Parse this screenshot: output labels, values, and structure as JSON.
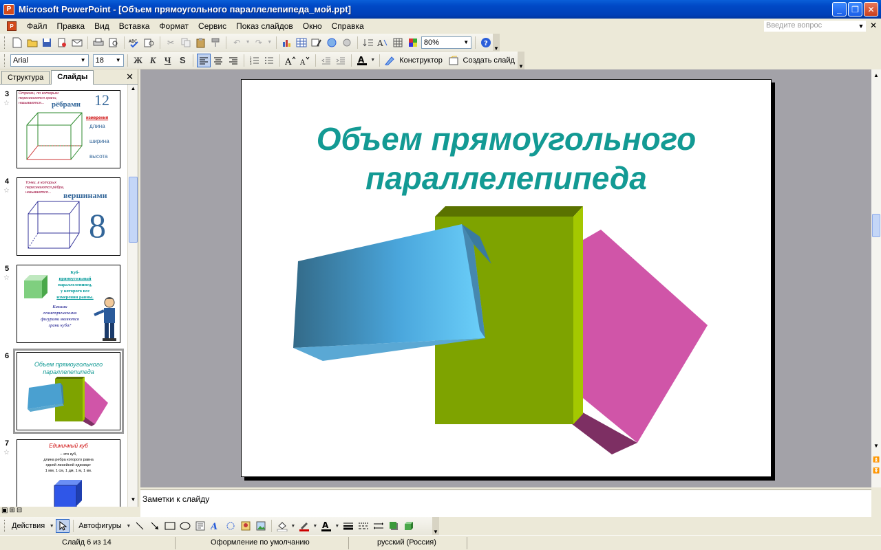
{
  "window": {
    "title": "Microsoft PowerPoint - [Объем прямоугольного параллелепипеда_мой.ppt]"
  },
  "menu": {
    "items": [
      "Файл",
      "Правка",
      "Вид",
      "Вставка",
      "Формат",
      "Сервис",
      "Показ слайдов",
      "Окно",
      "Справка"
    ],
    "question_placeholder": "Введите вопрос"
  },
  "toolbar1": {
    "zoom": "80%"
  },
  "toolbar2": {
    "font": "Arial",
    "size": "18",
    "bold": "Ж",
    "italic": "К",
    "underline": "Ч",
    "shadow": "S",
    "designer": "Конструктор",
    "new_slide": "Создать слайд"
  },
  "leftpanel": {
    "tabs": [
      "Структура",
      "Слайды"
    ],
    "slides": [
      {
        "num": "3",
        "text_top": "Отрезки, по которым пересекаются грани, называются...",
        "word": "рёбрами",
        "number": "12",
        "dims_title": "измерения",
        "dims": [
          "длина",
          "ширина",
          "высота"
        ]
      },
      {
        "num": "4",
        "text_top": "Точки, в которых пересекаются рёбра, называются...",
        "word": "вершинами",
        "number": "8"
      },
      {
        "num": "5",
        "text": [
          "Куб-",
          "прямоугольный",
          "параллелепипед,",
          "у которого все",
          "измерения равны."
        ],
        "question": [
          "Какими",
          "геометрическими",
          "фигурами являются",
          "грани куба?"
        ]
      },
      {
        "num": "6",
        "title": [
          "Объем прямоугольного",
          "параллелепипеда"
        ]
      },
      {
        "num": "7",
        "title": "Единичный куб",
        "lines": [
          "– это куб,",
          "длина ребра которого равна",
          "одной линейной единице:",
          "1 мм, 1 см, 1 дм, 1 м, 1 км."
        ]
      }
    ]
  },
  "slide": {
    "title_line1": "Объем прямоугольного",
    "title_line2": "параллелепипеда"
  },
  "notes": {
    "placeholder": "Заметки к слайду"
  },
  "drawbar": {
    "actions": "Действия",
    "autoshapes": "Автофигуры"
  },
  "status": {
    "slide": "Слайд 6 из 14",
    "design": "Оформление по умолчанию",
    "lang": "русский (Россия)"
  },
  "colors": {
    "title": "#139a94",
    "green": "#7ea300",
    "pink": "#d055a8",
    "blue_light": "#66ccf8",
    "blue_dark": "#336a88"
  }
}
